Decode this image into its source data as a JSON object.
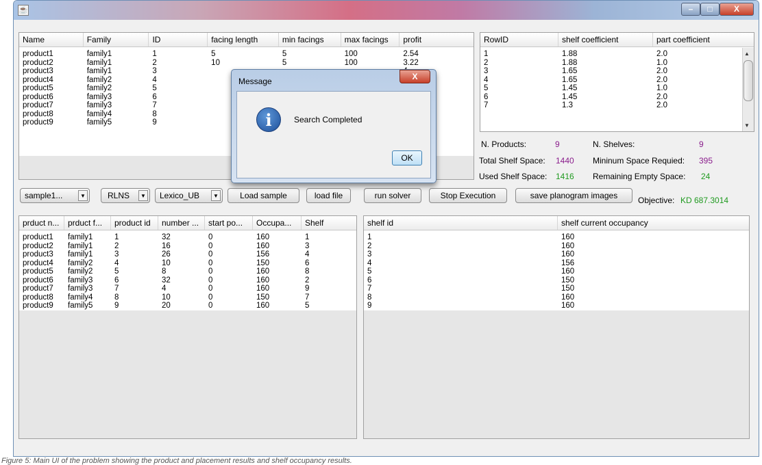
{
  "products": {
    "columns": [
      "Name",
      "Family",
      "ID",
      "facing length",
      "min facings",
      "max facings",
      "profit"
    ],
    "rows": [
      [
        "product1",
        "family1",
        "1",
        "5",
        "5",
        "100",
        "2.54"
      ],
      [
        "product2",
        "family1",
        "2",
        "10",
        "5",
        "100",
        "3.22"
      ],
      [
        "product3",
        "family1",
        "3",
        "",
        "",
        "",
        "4"
      ],
      [
        "product4",
        "family2",
        "4",
        "",
        "",
        "",
        "5"
      ],
      [
        "product5",
        "family2",
        "5",
        "",
        "",
        "",
        "5"
      ],
      [
        "product6",
        "family3",
        "6",
        "",
        "",
        "",
        ""
      ],
      [
        "product7",
        "family3",
        "7",
        "",
        "",
        "",
        "3"
      ],
      [
        "product8",
        "family4",
        "8",
        "",
        "",
        "",
        "4"
      ],
      [
        "product9",
        "family5",
        "9",
        "",
        "",
        "",
        "4"
      ]
    ]
  },
  "shelves": {
    "columns": [
      "RowID",
      "shelf coefficient",
      "part coefficient"
    ],
    "rows": [
      [
        "1",
        "1.88",
        "2.0"
      ],
      [
        "2",
        "1.88",
        "1.0"
      ],
      [
        "3",
        "1.65",
        "2.0"
      ],
      [
        "4",
        "1.65",
        "2.0"
      ],
      [
        "5",
        "1.45",
        "1.0"
      ],
      [
        "6",
        "1.45",
        "2.0"
      ],
      [
        "7",
        "1.3",
        "2.0"
      ]
    ]
  },
  "stats": {
    "n_products_label": "N. Products:",
    "n_products": "9",
    "n_shelves_label": "N. Shelves:",
    "n_shelves": "9",
    "total_space_label": "Total Shelf Space:",
    "total_space": "1440",
    "min_space_label": "Mininum Space Requied:",
    "min_space": "395",
    "used_space_label": "Used Shelf Space:",
    "used_space": "1416",
    "remaining_label": "Remaining Empty Space:",
    "remaining": "24",
    "objective_label": "Objective:",
    "objective": "KD 687.3014"
  },
  "toolbar": {
    "sample_combo": "sample1...",
    "algo_combo": "RLNS",
    "mode_combo": "Lexico_UB",
    "load_sample": "Load sample",
    "load_file": "load file",
    "run_solver": "run solver",
    "stop": "Stop Execution",
    "save_images": "save planogram images"
  },
  "placement": {
    "columns": [
      "prduct n...",
      "prduct f...",
      "product id",
      "number ...",
      "start po...",
      "Occupa...",
      "Shelf"
    ],
    "rows": [
      [
        "product1",
        "family1",
        "1",
        "32",
        "0",
        "160",
        "1"
      ],
      [
        "product2",
        "family1",
        "2",
        "16",
        "0",
        "160",
        "3"
      ],
      [
        "product3",
        "family1",
        "3",
        "26",
        "0",
        "156",
        "4"
      ],
      [
        "product4",
        "family2",
        "4",
        "10",
        "0",
        "150",
        "6"
      ],
      [
        "product5",
        "family2",
        "5",
        "8",
        "0",
        "160",
        "8"
      ],
      [
        "product6",
        "family3",
        "6",
        "32",
        "0",
        "160",
        "2"
      ],
      [
        "product7",
        "family3",
        "7",
        "4",
        "0",
        "160",
        "9"
      ],
      [
        "product8",
        "family4",
        "8",
        "10",
        "0",
        "150",
        "7"
      ],
      [
        "product9",
        "family5",
        "9",
        "20",
        "0",
        "160",
        "5"
      ]
    ]
  },
  "occupancy": {
    "columns": [
      "shelf id",
      "shelf current occupancy"
    ],
    "rows": [
      [
        "1",
        "160"
      ],
      [
        "2",
        "160"
      ],
      [
        "3",
        "160"
      ],
      [
        "4",
        "156"
      ],
      [
        "5",
        "160"
      ],
      [
        "6",
        "150"
      ],
      [
        "7",
        "150"
      ],
      [
        "8",
        "160"
      ],
      [
        "9",
        "160"
      ]
    ]
  },
  "dialog": {
    "title": "Message",
    "message": "Search Completed",
    "ok": "OK",
    "close": "X"
  },
  "window": {
    "minimize": "–",
    "maximize": "□",
    "close": "X"
  },
  "caption": "Figure 5: Main UI of the problem showing the product and placement results and shelf occupancy results."
}
